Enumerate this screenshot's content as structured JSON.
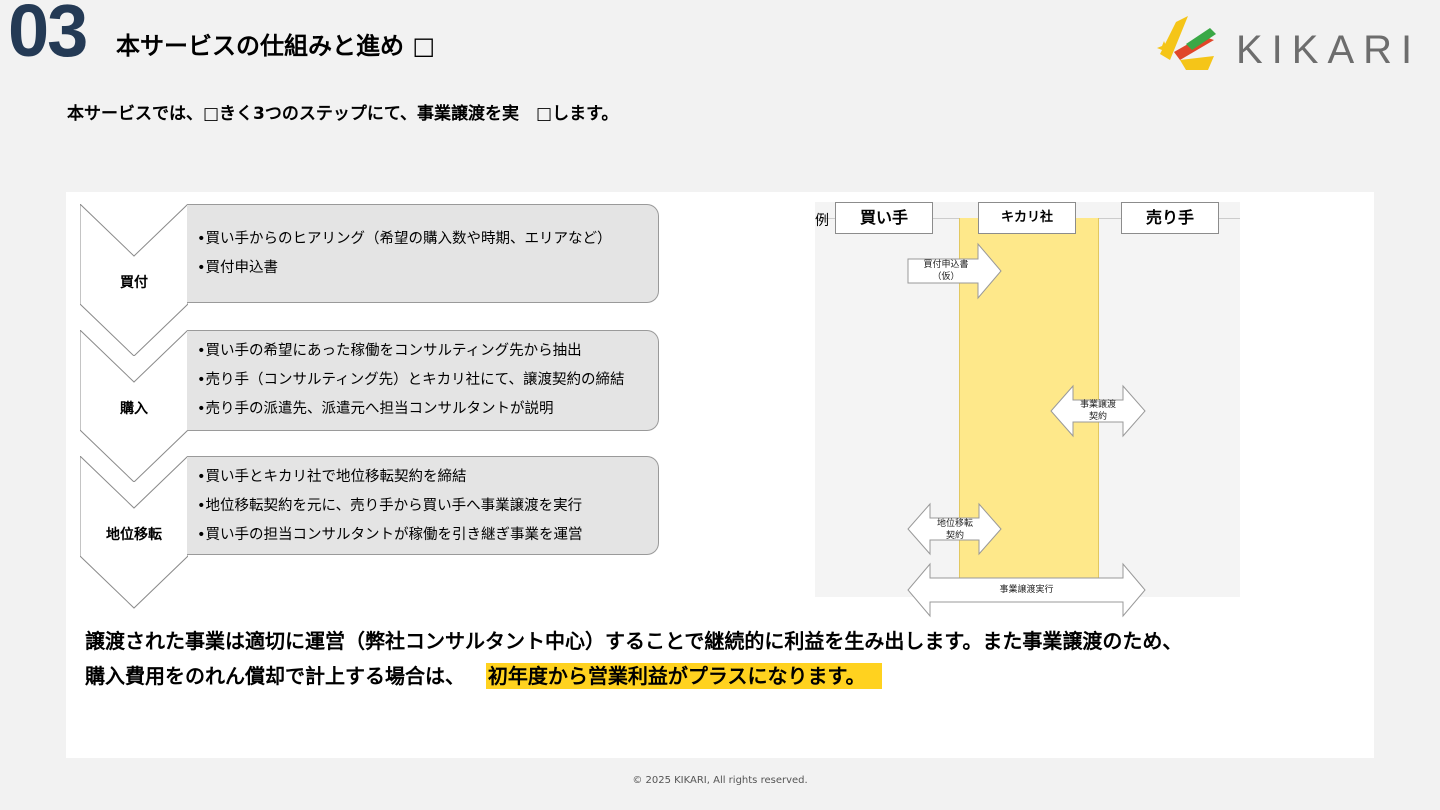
{
  "header": {
    "section_number": "03",
    "title": "本サービスの仕組みと進め □",
    "lead": "本サービスでは、□きく3つのステップにて、事業譲渡を実　□します。"
  },
  "logo": {
    "text": "KIKARI",
    "colors": [
      "#f5c518",
      "#e0462a",
      "#3aa846"
    ]
  },
  "steps": [
    {
      "label": "買付",
      "bullets": [
        "•買い手からのヒアリング（希望の購入数や時期、エリアなど）",
        "•買付申込書"
      ]
    },
    {
      "label": "購入",
      "bullets": [
        "•買い手の希望にあった稼働をコンサルティング先から抽出",
        "•売り手（コンサルティング先）とキカリ社にて、譲渡契約の締結",
        "•売り手の派遣先、派遣元へ担当コンサルタントが説明"
      ]
    },
    {
      "label": "地位移転",
      "bullets": [
        "•買い手とキカリ社で地位移転契約を締結",
        "•地位移転契約を元に、売り手から買い手へ事業譲渡を実行",
        "•買い手の担当コンサルタントが稼働を引き継ぎ事業を運営"
      ]
    }
  ],
  "flow": {
    "example_label": "例",
    "buyer": "買い手",
    "kikari": "キカリ社",
    "seller": "売り手",
    "arrow_application": [
      "買付申込書",
      "（仮）"
    ],
    "arrow_transfer_contract": [
      "事業譲渡",
      "契約"
    ],
    "arrow_position_contract": [
      "地位移転",
      "契約"
    ],
    "arrow_execution": "事業譲渡実行",
    "lane_color": "#fee88a"
  },
  "conclusion": {
    "line1": "譲渡された事業は適切に運営（弊社コンサルタント中心）することで継続的に利益を生み出します。また事業譲渡のため、",
    "line2_prefix": "購入費用をのれん償却で計上する場合は、",
    "line2_highlight": "初年度から営業利益がプラスになります。",
    "highlight_color": "#ffd21f"
  },
  "footer": "© 2025 KIKARI, All rights reserved."
}
